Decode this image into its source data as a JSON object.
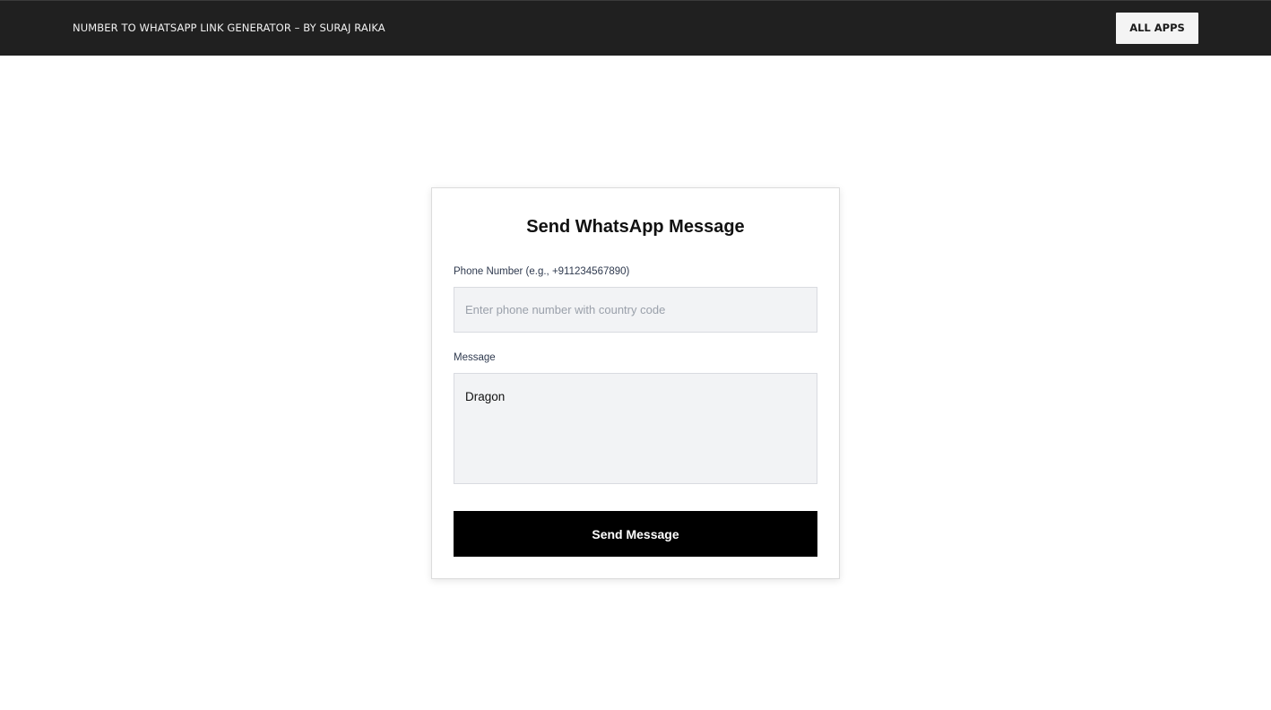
{
  "header": {
    "title": "NUMBER TO WHATSAPP LINK GENERATOR – BY SURAJ RAIKA",
    "all_apps_label": "ALL APPS"
  },
  "form": {
    "title": "Send WhatsApp Message",
    "phone_label": "Phone Number (e.g., +911234567890)",
    "phone_placeholder": "Enter phone number with country code",
    "phone_value": "",
    "message_label": "Message",
    "message_value": "Dragon",
    "submit_label": "Send Message"
  },
  "colors": {
    "header_bg": "#202020",
    "button_bg": "#000000",
    "input_bg": "#f2f3f5"
  }
}
